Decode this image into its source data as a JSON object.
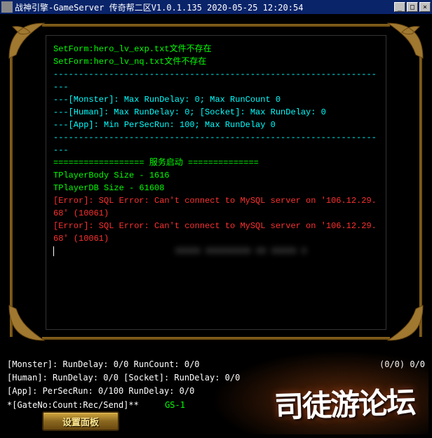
{
  "titlebar": {
    "text": "战神引擎-GameServer 传奇帮二区V1.0.1.135 2020-05-25 12:20:54",
    "min": "_",
    "max": "□",
    "close": "×"
  },
  "console": {
    "lines": [
      {
        "cls": "c-green",
        "text": "SetForm:hero_lv_exp.txt文件不存在"
      },
      {
        "cls": "c-green",
        "text": "SetForm:hero_lv_nq.txt文件不存在"
      },
      {
        "cls": "c-cyan",
        "text": "-------------------------------------------------------------------"
      },
      {
        "cls": "c-cyan",
        "text": "---[Monster]: Max RunDelay: 0; Max RunCount 0"
      },
      {
        "cls": "c-cyan",
        "text": "---[Human]: Max RunDelay: 0; [Socket]: Max RunDelay: 0"
      },
      {
        "cls": "c-cyan",
        "text": "---[App]: Min PerSecRun: 100; Max RunDelay 0"
      },
      {
        "cls": "c-cyan",
        "text": "-------------------------------------------------------------------"
      },
      {
        "cls": "c-cyan",
        "text": ""
      },
      {
        "cls": "c-green",
        "text": "================== 服务启动 =============="
      },
      {
        "cls": "c-green",
        "text": "TPlayerBody Size - 1616"
      },
      {
        "cls": "c-green",
        "text": "TPlayerDB Size - 61608"
      },
      {
        "cls": "c-red",
        "text": "[Error]: SQL Error: Can't connect to MySQL server on '106.12.29.68' (10061)"
      },
      {
        "cls": "c-red",
        "text": "[Error]: SQL Error: Can't connect to MySQL server on '106.12.29.68' (10061)"
      }
    ]
  },
  "status": {
    "line1_left": "[Monster]: RunDelay: 0/0 RunCount: 0/0",
    "line1_right": "(0/0) 0/0",
    "line2": "[Human]: RunDelay: 0/0 [Socket]: RunDelay: 0/0",
    "line3": "[App]: PerSecRun: 0/100 RunDelay: 0/0",
    "line4_prefix": "*[GateNo:Count:Rec/Send]**",
    "line4_gs": "GS-1"
  },
  "buttons": {
    "settings": "设置面板"
  },
  "forum_logo_text": "司徒游论坛"
}
